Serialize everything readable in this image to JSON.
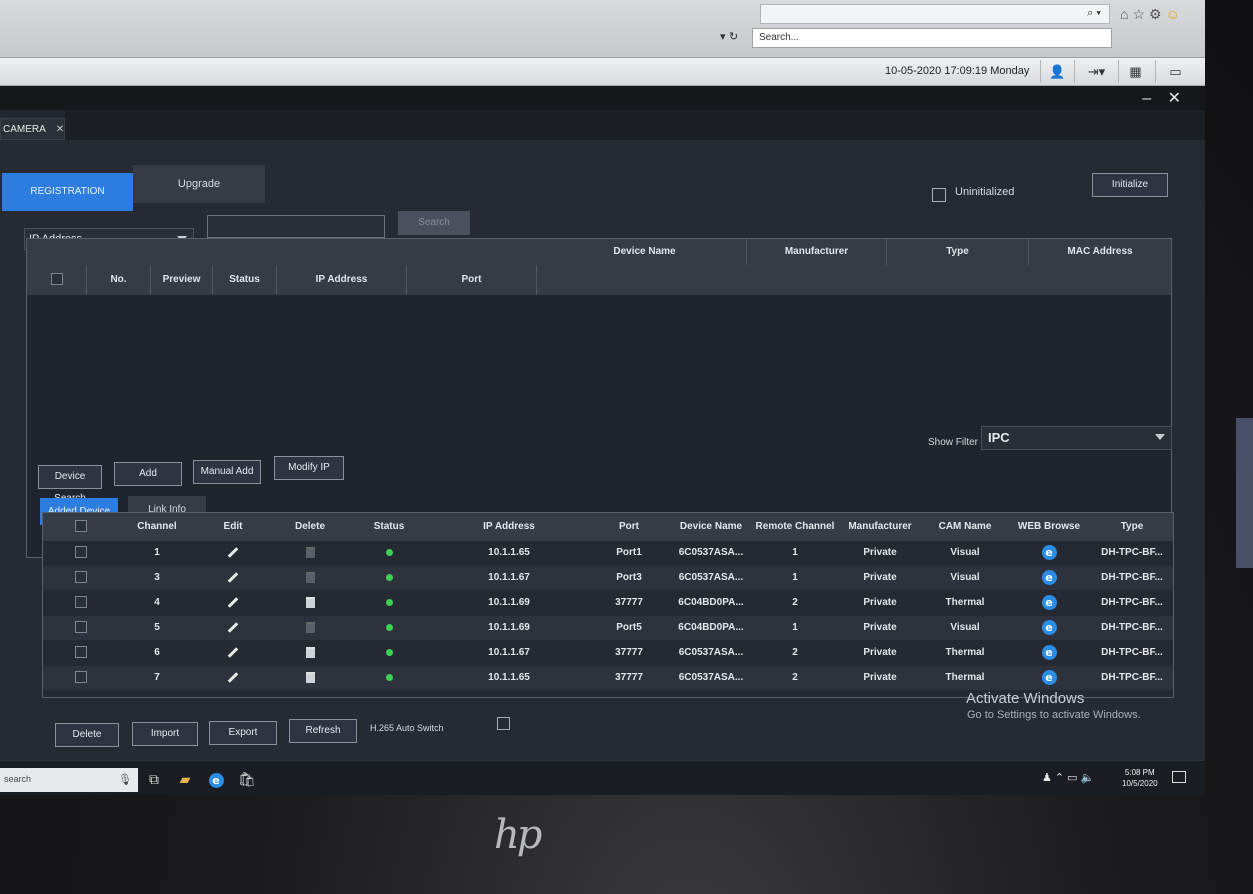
{
  "browser": {
    "address_search_placeholder": "Search...",
    "address_controls": "▾ ↻",
    "top_search_icon": "search-icon",
    "toolbar_icons": [
      "home-icon",
      "star-icon",
      "gear-icon",
      "smiley-icon"
    ]
  },
  "header": {
    "datetime": "10-05-2020 17:09:19 Monday",
    "icons": [
      "user-icon",
      "logout-icon",
      "grid-icon",
      "monitor-icon"
    ],
    "window_controls": "– ✕"
  },
  "module_tab": {
    "label": "CAMERA",
    "close": "✕"
  },
  "tabs": {
    "registration": "REGISTRATION",
    "upgrade": "Upgrade"
  },
  "uninitialized": {
    "label": "Uninitialized",
    "checked": false
  },
  "buttons": {
    "initialize": "Initialize",
    "search": "Search",
    "device_search": "Device Search",
    "add": "Add",
    "manual_add": "Manual Add",
    "modify_ip": "Modify IP",
    "delete": "Delete",
    "import": "Import",
    "export": "Export",
    "refresh": "Refresh"
  },
  "filter": {
    "field": "IP Address",
    "query": ""
  },
  "search_table": {
    "columns": [
      "",
      "No.",
      "Preview",
      "Status",
      "IP Address",
      "Port",
      "Device Name",
      "Manufacturer",
      "Type",
      "MAC Address"
    ],
    "rows": []
  },
  "show_filter": {
    "label": "Show Filter",
    "value": "IPC"
  },
  "device_tabs": {
    "added_device": "Added Device",
    "link_info": "Link Info"
  },
  "device_table": {
    "columns": [
      "",
      "Channel",
      "Edit",
      "Delete",
      "Status",
      "IP Address",
      "Port",
      "Device Name",
      "Remote Channel",
      "Manufacturer",
      "CAM Name",
      "WEB Browse",
      "Type"
    ],
    "rows": [
      {
        "channel": "1",
        "delete_enabled": false,
        "ip": "10.1.1.65",
        "port": "Port1",
        "device_name": "6C0537ASA...",
        "remote_channel": "1",
        "manufacturer": "Private",
        "cam_name": "Visual",
        "type": "DH-TPC-BF..."
      },
      {
        "channel": "3",
        "delete_enabled": false,
        "ip": "10.1.1.67",
        "port": "Port3",
        "device_name": "6C0537ASA...",
        "remote_channel": "1",
        "manufacturer": "Private",
        "cam_name": "Visual",
        "type": "DH-TPC-BF..."
      },
      {
        "channel": "4",
        "delete_enabled": true,
        "ip": "10.1.1.69",
        "port": "37777",
        "device_name": "6C04BD0PA...",
        "remote_channel": "2",
        "manufacturer": "Private",
        "cam_name": "Thermal",
        "type": "DH-TPC-BF..."
      },
      {
        "channel": "5",
        "delete_enabled": false,
        "ip": "10.1.1.69",
        "port": "Port5",
        "device_name": "6C04BD0PA...",
        "remote_channel": "1",
        "manufacturer": "Private",
        "cam_name": "Visual",
        "type": "DH-TPC-BF..."
      },
      {
        "channel": "6",
        "delete_enabled": true,
        "ip": "10.1.1.67",
        "port": "37777",
        "device_name": "6C0537ASA...",
        "remote_channel": "2",
        "manufacturer": "Private",
        "cam_name": "Thermal",
        "type": "DH-TPC-BF..."
      },
      {
        "channel": "7",
        "delete_enabled": true,
        "ip": "10.1.1.65",
        "port": "37777",
        "device_name": "6C0537ASA...",
        "remote_channel": "2",
        "manufacturer": "Private",
        "cam_name": "Thermal",
        "type": "DH-TPC-BF..."
      }
    ]
  },
  "h265": {
    "label": "H.265 Auto Switch",
    "checked": false
  },
  "watermark": {
    "title": "Activate Windows",
    "subtitle": "Go to Settings to activate Windows."
  },
  "taskbar": {
    "search_placeholder": "search",
    "apps": [
      "task-view-icon",
      "file-explorer-icon",
      "internet-explorer-icon",
      "store-icon"
    ],
    "tray_icons": [
      "people-icon",
      "chevron-up-icon",
      "battery-icon",
      "volume-icon"
    ],
    "time": "5:08 PM",
    "date": "10/5/2020"
  },
  "colors": {
    "accent": "#2d7de0",
    "status_online": "#39d353",
    "ie_blue": "#2a8de6"
  },
  "brand": "hp"
}
